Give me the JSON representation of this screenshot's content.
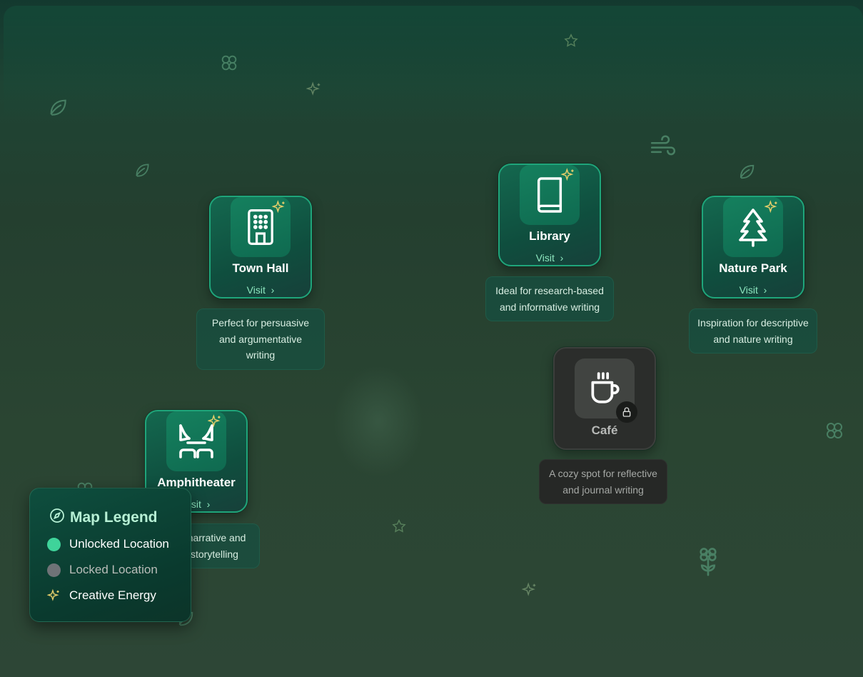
{
  "locations": [
    {
      "id": "town-hall",
      "name": "Town Hall",
      "visit": "Visit",
      "description": "Perfect for persuasive and argumentative writing",
      "locked": false,
      "icon": "building-icon"
    },
    {
      "id": "library",
      "name": "Library",
      "visit": "Visit",
      "description": "Ideal for research-based and informative writing",
      "locked": false,
      "icon": "book-icon"
    },
    {
      "id": "nature-park",
      "name": "Nature Park",
      "visit": "Visit",
      "description": "Inspiration for descriptive and nature writing",
      "locked": false,
      "icon": "tree-icon"
    },
    {
      "id": "cafe",
      "name": "Café",
      "visit": "",
      "description": "A cozy spot for reflective and journal writing",
      "locked": true,
      "icon": "coffee-cup-icon"
    },
    {
      "id": "amphitheater",
      "name": "Amphitheater",
      "visit": "Visit",
      "description": "Great for narrative and creative storytelling",
      "locked": false,
      "icon": "theater-curtains-icon"
    }
  ],
  "legend": {
    "title": "Map Legend",
    "items": [
      {
        "label": "Unlocked Location",
        "color": "#3fd39a"
      },
      {
        "label": "Locked Location",
        "color": "#6f7377"
      },
      {
        "label": "Creative Energy",
        "color": "#e3cd6a",
        "icon": "sparkles-icon"
      }
    ]
  },
  "colors": {
    "accent": "#1fa57a",
    "visit_link": "#8de7bf",
    "spark": "#e3cd6a"
  }
}
